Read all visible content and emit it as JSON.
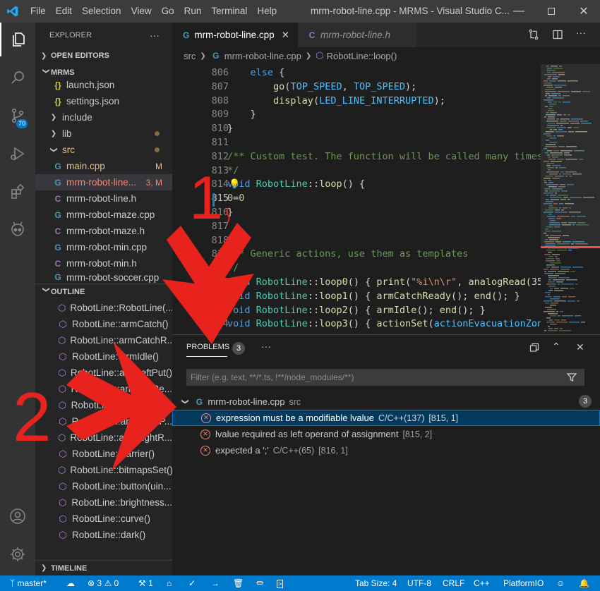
{
  "titlebar": {
    "menu": [
      "File",
      "Edit",
      "Selection",
      "View",
      "Go",
      "Run",
      "Terminal",
      "Help"
    ],
    "window_title": "mrm-robot-line.cpp - MRMS - Visual Studio C..."
  },
  "activity": {
    "source_control_badge": "70"
  },
  "sidebar": {
    "title": "EXPLORER",
    "more": "···",
    "open_editors": "OPEN EDITORS",
    "folder": "MRMS",
    "files": [
      {
        "name": "launch.json",
        "type": "json"
      },
      {
        "name": "settings.json",
        "type": "json"
      },
      {
        "name": "include",
        "type": "folder"
      },
      {
        "name": "lib",
        "type": "folder"
      },
      {
        "name": "src",
        "type": "folder-open"
      },
      {
        "name": "main.cpp",
        "type": "cpp",
        "status": "M"
      },
      {
        "name": "mrm-robot-line...",
        "type": "cpp",
        "status": "3, M"
      },
      {
        "name": "mrm-robot-line.h",
        "type": "h"
      },
      {
        "name": "mrm-robot-maze.cpp",
        "type": "cpp"
      },
      {
        "name": "mrm-robot-maze.h",
        "type": "h"
      },
      {
        "name": "mrm-robot-min.cpp",
        "type": "cpp"
      },
      {
        "name": "mrm-robot-min.h",
        "type": "h"
      },
      {
        "name": "mrm-robot-soccer.cpp",
        "type": "cpp"
      }
    ],
    "outline_title": "OUTLINE",
    "outline": [
      "RobotLine::RobotLine(...",
      "RobotLine::armCatch()",
      "RobotLine::armCatchR...",
      "RobotLine::armIdle()",
      "RobotLine::armLeftPut()",
      "RobotLine::armLeftRe...",
      "RobotLine::armLeftRe...",
      "RobotLine::armRightP...",
      "RobotLine::armRightR...",
      "RobotLine::barrier()",
      "RobotLine::bitmapsSet()",
      "RobotLine::button(uin...",
      "RobotLine::brightness...",
      "RobotLine::curve()",
      "RobotLine::dark()"
    ],
    "timeline": "TIMELINE"
  },
  "editor": {
    "tabs": [
      {
        "label": "mrm-robot-line.cpp",
        "active": true
      },
      {
        "label": "mrm-robot-line.h",
        "active": false
      }
    ],
    "breadcrumb": {
      "folder": "src",
      "file": "mrm-robot-line.cpp",
      "symbol": "RobotLine::loop()"
    },
    "lines": [
      {
        "n": "806",
        "t": "    else {"
      },
      {
        "n": "807",
        "t": "        go(TOP_SPEED, TOP_SPEED);"
      },
      {
        "n": "808",
        "t": "        display(LED_LINE_INTERRUPTED);"
      },
      {
        "n": "809",
        "t": "    }"
      },
      {
        "n": "810",
        "t": "}"
      },
      {
        "n": "811",
        "t": ""
      },
      {
        "n": "812",
        "t": "/** Custom test. The function will be called many times"
      },
      {
        "n": "813",
        "t": "*/"
      },
      {
        "n": "814",
        "t": "void RobotLine::loop() {"
      },
      {
        "n": "815",
        "t": "0=0"
      },
      {
        "n": "816",
        "t": "}"
      },
      {
        "n": "817",
        "t": ""
      },
      {
        "n": "818",
        "t": ""
      },
      {
        "n": "819",
        "t": "/** Generic actions, use them as templates"
      },
      {
        "n": "820",
        "t": "*/"
      },
      {
        "n": "821",
        "t": "void RobotLine::loop0() { print(\"%i\\n\\r\", analogRead(35)"
      },
      {
        "n": "822",
        "t": "void RobotLine::loop1() { armCatchReady(); end(); }"
      },
      {
        "n": "823",
        "t": "void RobotLine::loop2() { armIdle(); end(); }"
      },
      {
        "n": "824",
        "t": "void RobotLine::loop3() { actionSet(actionEvacuationZone"
      }
    ]
  },
  "panel": {
    "tab": "PROBLEMS",
    "count": "3",
    "more": "···",
    "filter_placeholder": "Filter (e.g. text, **/*.ts, !**/node_modules/**)",
    "file": {
      "name": "mrm-robot-line.cpp",
      "folder": "src",
      "count": "3"
    },
    "problems": [
      {
        "message": "expression must be a modifiable lvalue",
        "source": "C/C++(137)",
        "loc": "[815, 1]"
      },
      {
        "message": "lvalue required as left operand of assignment",
        "source": "",
        "loc": "[815, 2]"
      },
      {
        "message": "expected a ';'",
        "source": "C/C++(65)",
        "loc": "[816, 1]"
      }
    ]
  },
  "statusbar": {
    "branch": "master*",
    "errors": "3",
    "warnings": "0",
    "tools": "1",
    "tab_size": "Tab Size: 4",
    "encoding": "UTF-8",
    "eol": "CRLF",
    "language": "C++",
    "platform": "PlatformIO"
  },
  "annotations": {
    "one": "1",
    "two": "2"
  },
  "colors": {
    "accent": "#007acc",
    "error": "#f48771",
    "arrow": "#e8231e",
    "selected_row": "#04395e"
  }
}
